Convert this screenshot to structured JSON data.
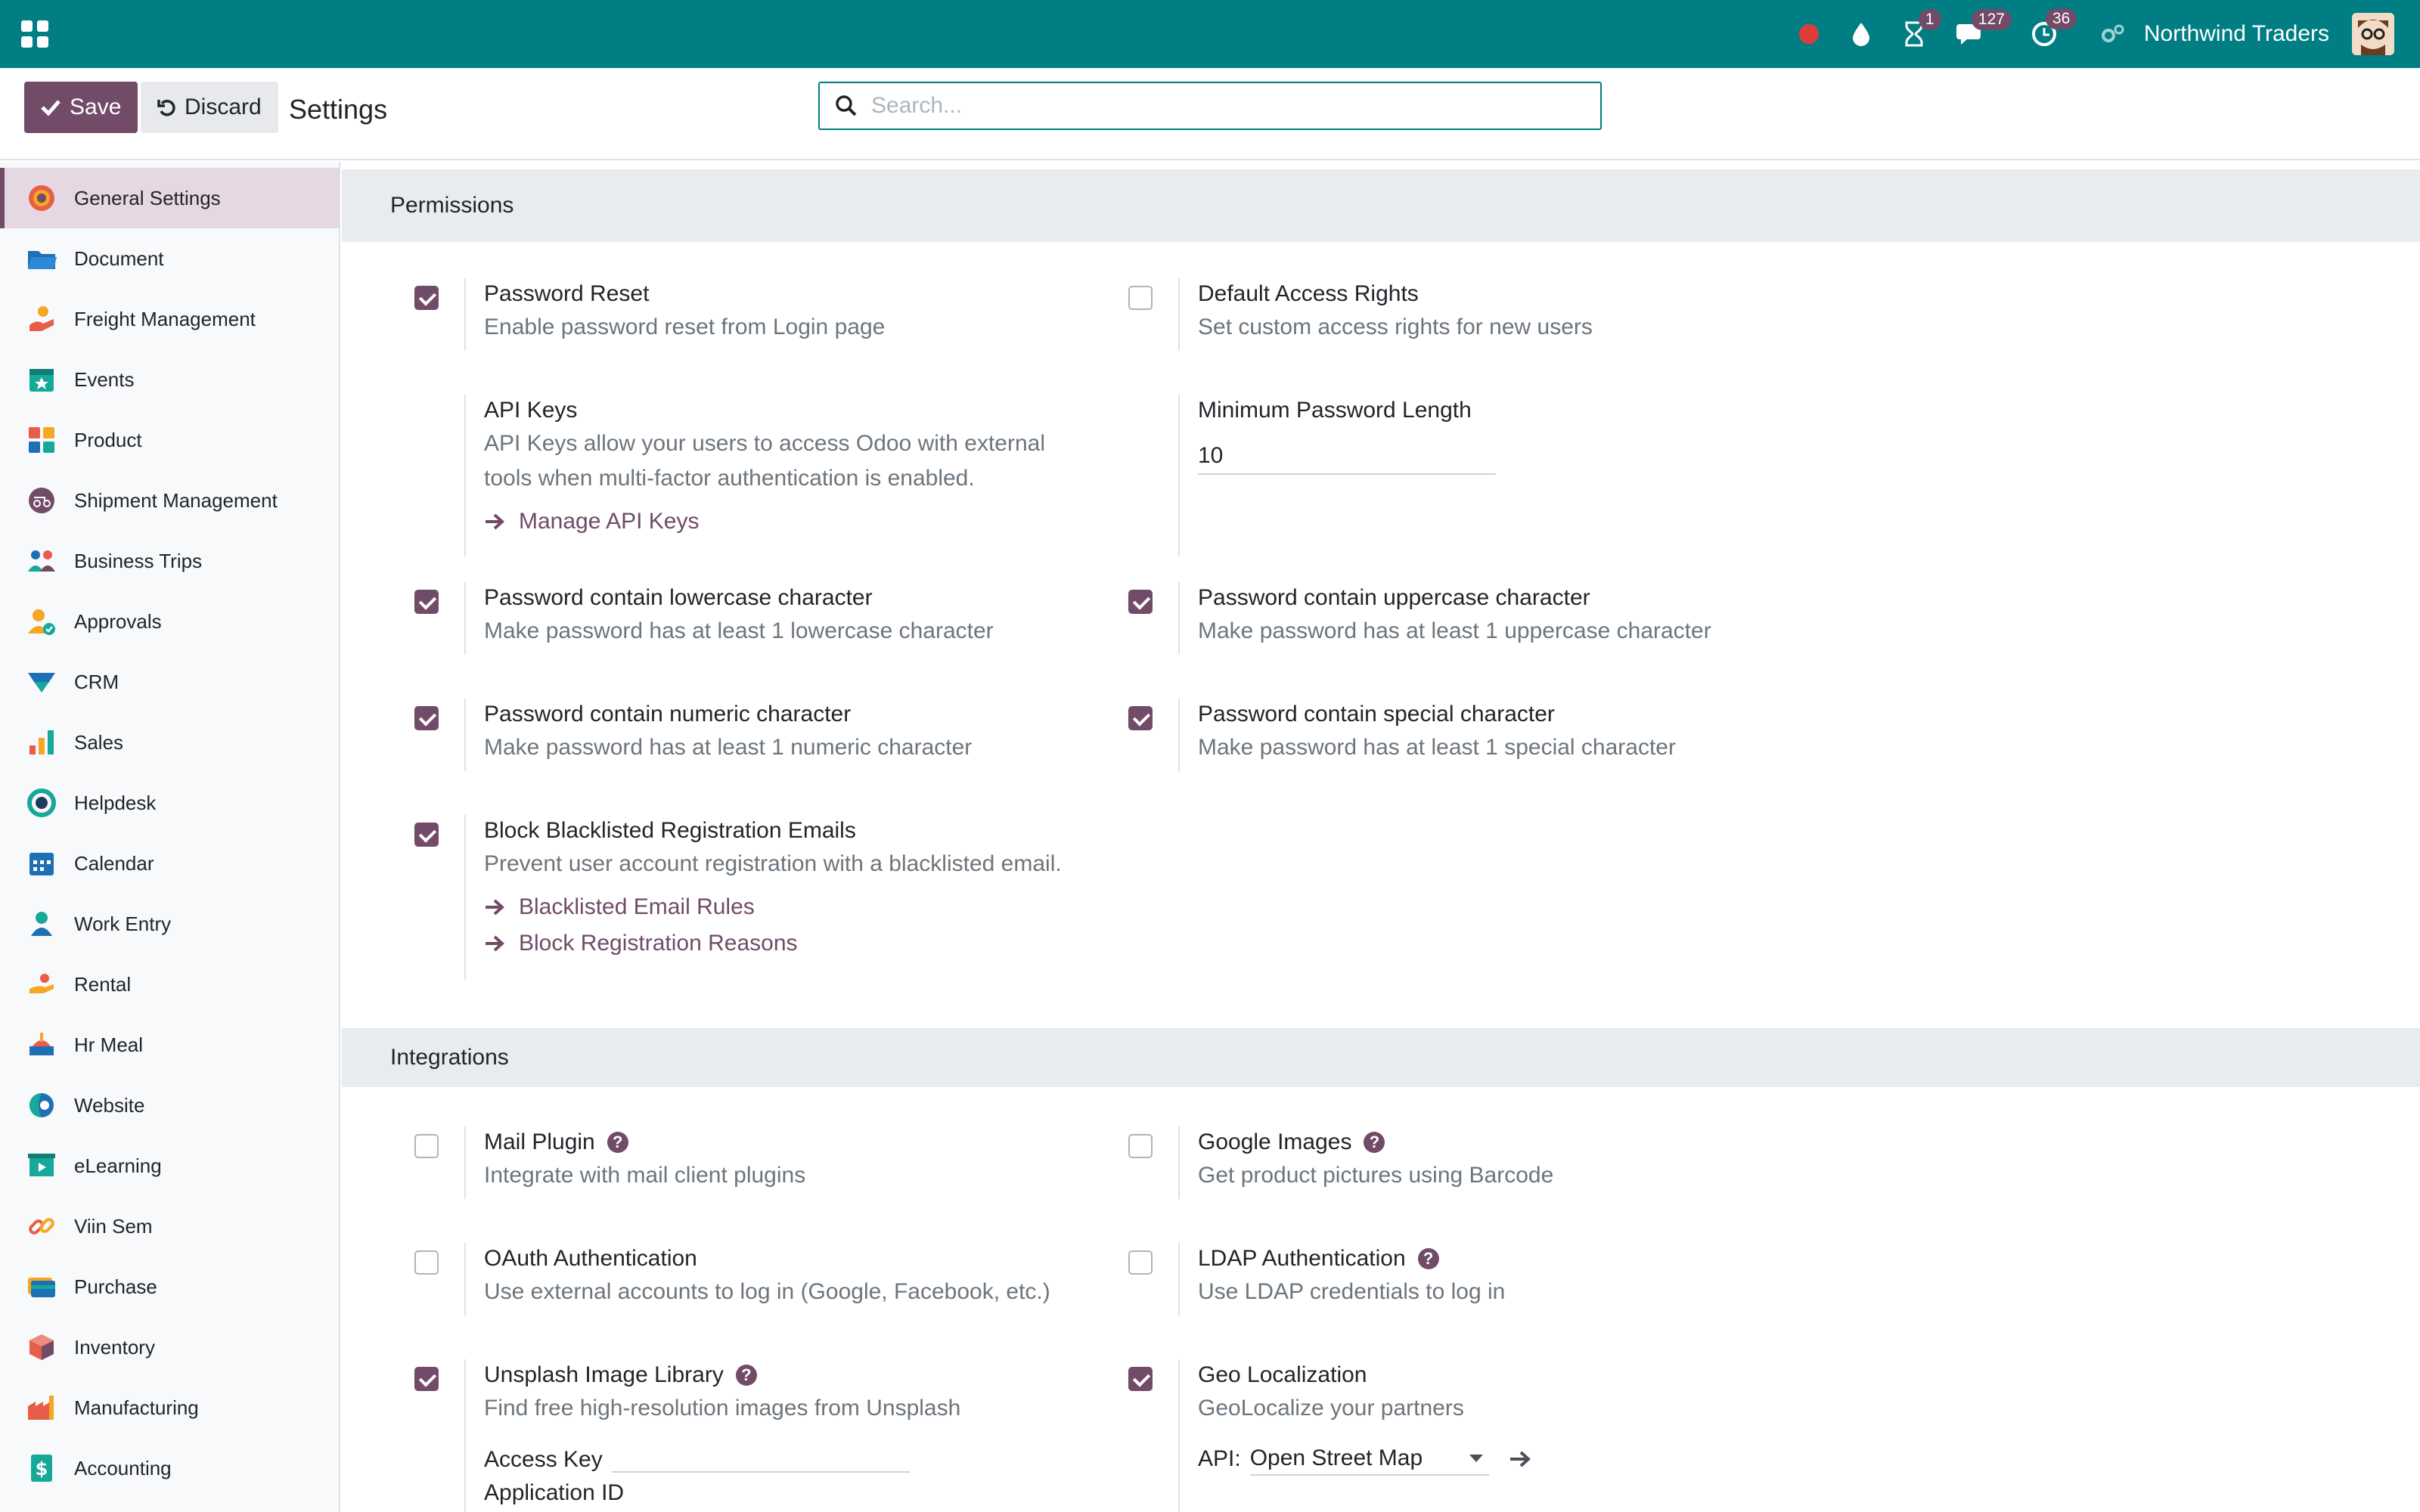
{
  "navbar": {
    "badges": {
      "activities": "1",
      "messages": "127",
      "clock": "36"
    },
    "company": "Northwind Traders"
  },
  "control": {
    "save_label": "Save",
    "discard_label": "Discard",
    "breadcrumb": "Settings",
    "search_placeholder": "Search..."
  },
  "sidebar": {
    "items": [
      {
        "label": "General Settings"
      },
      {
        "label": "Document"
      },
      {
        "label": "Freight Management"
      },
      {
        "label": "Events"
      },
      {
        "label": "Product"
      },
      {
        "label": "Shipment Management"
      },
      {
        "label": "Business Trips"
      },
      {
        "label": "Approvals"
      },
      {
        "label": "CRM"
      },
      {
        "label": "Sales"
      },
      {
        "label": "Helpdesk"
      },
      {
        "label": "Calendar"
      },
      {
        "label": "Work Entry"
      },
      {
        "label": "Rental"
      },
      {
        "label": "Hr Meal"
      },
      {
        "label": "Website"
      },
      {
        "label": "eLearning"
      },
      {
        "label": "Viin Sem"
      },
      {
        "label": "Purchase"
      },
      {
        "label": "Inventory"
      },
      {
        "label": "Manufacturing"
      },
      {
        "label": "Accounting"
      }
    ]
  },
  "permissions": {
    "title": "Permissions",
    "password_reset": {
      "title": "Password Reset",
      "desc": "Enable password reset from Login page",
      "checked": true
    },
    "default_access": {
      "title": "Default Access Rights",
      "desc": "Set custom access rights for new users",
      "checked": false
    },
    "api_keys": {
      "title": "API Keys",
      "desc1": "API Keys allow your users to access Odoo with external",
      "desc2": "tools when multi-factor authentication is enabled.",
      "link": "Manage API Keys"
    },
    "min_length": {
      "title": "Minimum Password Length",
      "value": "10"
    },
    "lowercase": {
      "title": "Password contain lowercase character",
      "desc": "Make password has at least 1 lowercase character",
      "checked": true
    },
    "uppercase": {
      "title": "Password contain uppercase character",
      "desc": "Make password has at least 1 uppercase character",
      "checked": true
    },
    "numeric": {
      "title": "Password contain numeric character",
      "desc": "Make password has at least 1 numeric character",
      "checked": true
    },
    "special": {
      "title": "Password contain special character",
      "desc": "Make password has at least 1 special character",
      "checked": true
    },
    "blacklist": {
      "title": "Block Blacklisted Registration Emails",
      "desc": "Prevent user account registration with a blacklisted email.",
      "link1": "Blacklisted Email Rules",
      "link2": "Block Registration Reasons",
      "checked": true
    }
  },
  "integrations": {
    "title": "Integrations",
    "mail_plugin": {
      "title": "Mail Plugin",
      "desc": "Integrate with mail client plugins",
      "checked": false
    },
    "google_images": {
      "title": "Google Images",
      "desc": "Get product pictures using Barcode",
      "checked": false
    },
    "oauth": {
      "title": "OAuth Authentication",
      "desc": "Use external accounts to log in (Google, Facebook, etc.)",
      "checked": false
    },
    "ldap": {
      "title": "LDAP Authentication",
      "desc": "Use LDAP credentials to log in",
      "checked": false
    },
    "unsplash": {
      "title": "Unsplash Image Library",
      "desc": "Find free high-resolution images from Unsplash",
      "access_key_label": "Access Key",
      "app_id_label": "Application ID",
      "checked": true
    },
    "geo": {
      "title": "Geo Localization",
      "desc": "GeoLocalize your partners",
      "api_label": "API:",
      "api_value": "Open Street Map",
      "checked": true
    }
  },
  "colors": {
    "navbar": "#017e84",
    "brand": "#714b67",
    "section": "#e9ecef"
  }
}
